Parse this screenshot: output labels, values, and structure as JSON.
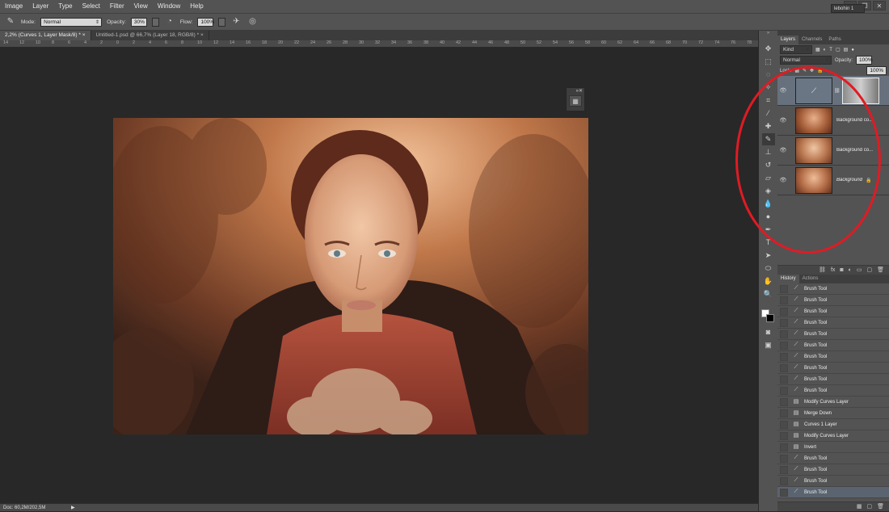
{
  "menu": [
    "Image",
    "Layer",
    "Type",
    "Select",
    "Filter",
    "View",
    "Window",
    "Help"
  ],
  "options": {
    "mode_label": "Mode:",
    "mode_value": "Normal",
    "opacity_label": "Opacity:",
    "opacity_value": "30%",
    "flow_label": "Flow:",
    "flow_value": "100%",
    "workspace": "lebohin 1"
  },
  "tabs": [
    {
      "label": "2,2% (Curves 1, Layer Mask/8) *",
      "active": true
    },
    {
      "label": "Untitled-1.psd @ 66,7% (Layer 18, RGB/8) *",
      "active": false
    }
  ],
  "ruler_ticks": [
    "14",
    "12",
    "10",
    "8",
    "6",
    "4",
    "2",
    "0",
    "2",
    "4",
    "6",
    "8",
    "10",
    "12",
    "14",
    "16",
    "18",
    "20",
    "22",
    "24",
    "26",
    "28",
    "30",
    "32",
    "34",
    "36",
    "38",
    "40",
    "42",
    "44",
    "46",
    "48",
    "50",
    "52",
    "54",
    "56",
    "58",
    "60",
    "62",
    "64",
    "66",
    "68",
    "70",
    "72",
    "74",
    "76",
    "78"
  ],
  "status": "Doc: 60,2M/202,5M",
  "layers_panel": {
    "tabs": [
      "Layers",
      "Channels",
      "Paths"
    ],
    "kind": "Kind",
    "blend": "Normal",
    "opacity_label": "Opacity:",
    "opacity_value": "100%",
    "lock_label": "Lock:",
    "fill_value": "100%",
    "layers": [
      {
        "name": "",
        "selected": true
      },
      {
        "name": "Background co...",
        "selected": false
      },
      {
        "name": "Background co...",
        "selected": false
      },
      {
        "name": "Background",
        "selected": false
      }
    ]
  },
  "history_panel": {
    "tabs": [
      "History",
      "Actions"
    ],
    "items": [
      {
        "label": "Brush Tool",
        "icon": "brush"
      },
      {
        "label": "Brush Tool",
        "icon": "brush"
      },
      {
        "label": "Brush Tool",
        "icon": "brush"
      },
      {
        "label": "Brush Tool",
        "icon": "brush"
      },
      {
        "label": "Brush Tool",
        "icon": "brush"
      },
      {
        "label": "Brush Tool",
        "icon": "brush"
      },
      {
        "label": "Brush Tool",
        "icon": "brush"
      },
      {
        "label": "Brush Tool",
        "icon": "brush"
      },
      {
        "label": "Brush Tool",
        "icon": "brush"
      },
      {
        "label": "Brush Tool",
        "icon": "brush"
      },
      {
        "label": "Modify Curves Layer",
        "icon": "doc"
      },
      {
        "label": "Merge Down",
        "icon": "doc"
      },
      {
        "label": "Curves 1 Layer",
        "icon": "doc"
      },
      {
        "label": "Modify Curves Layer",
        "icon": "doc"
      },
      {
        "label": "Invert",
        "icon": "doc"
      },
      {
        "label": "Brush Tool",
        "icon": "brush"
      },
      {
        "label": "Brush Tool",
        "icon": "brush"
      },
      {
        "label": "Brush Tool",
        "icon": "brush"
      },
      {
        "label": "Brush Tool",
        "icon": "brush"
      }
    ]
  }
}
